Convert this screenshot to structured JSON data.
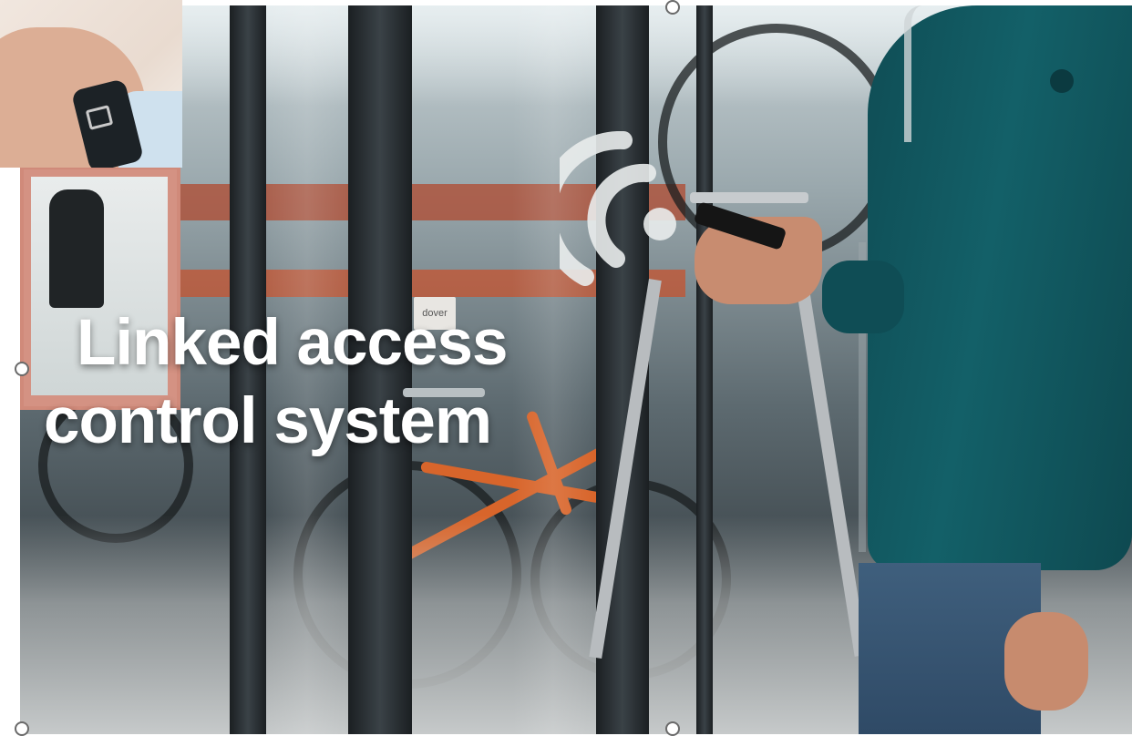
{
  "scene": {
    "headline": {
      "line1": "Linked access",
      "line2": "control system"
    },
    "door_sign": "dover",
    "wireless_icon": "contactless-wave-icon"
  },
  "thumbnail": {
    "icon": "smart-wristband"
  },
  "colors": {
    "jacket": "#136068",
    "bike_frame": "#d8652b",
    "rack": "#b04a2f",
    "headline_text": "#ffffff"
  }
}
